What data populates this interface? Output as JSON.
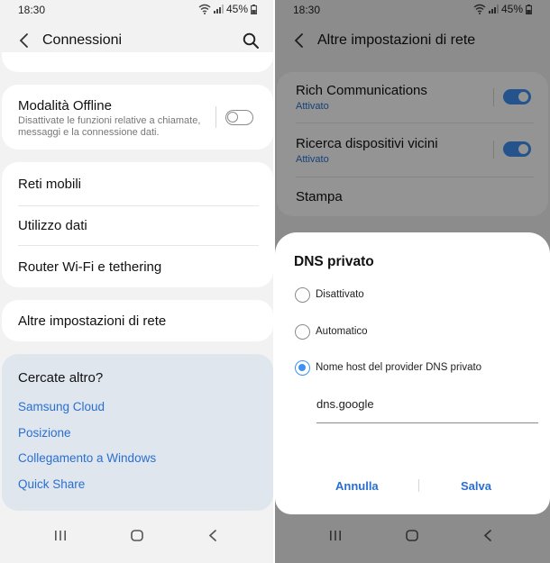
{
  "status": {
    "time": "18:30",
    "battery": "45%"
  },
  "left": {
    "title": "Connessioni",
    "offline": {
      "title": "Modalità Offline",
      "subtitle_line1": "Disattivate le funzioni relative a chiamate,",
      "subtitle_line2": "messaggi e la connessione dati.",
      "enabled": false
    },
    "menu": [
      "Reti mobili",
      "Utilizzo dati",
      "Router Wi-Fi e tethering"
    ],
    "more_settings": "Altre impostazioni di rete",
    "suggest": {
      "title": "Cercate altro?",
      "links": [
        "Samsung Cloud",
        "Posizione",
        "Collegamento a Windows",
        "Quick Share"
      ]
    }
  },
  "right": {
    "title": "Altre impostazioni di rete",
    "rows": [
      {
        "title": "Rich Communications",
        "subtitle": "Attivato",
        "enabled": true
      },
      {
        "title": "Ricerca dispositivi vicini",
        "subtitle": "Attivato",
        "enabled": true
      }
    ],
    "stampa": "Stampa",
    "dialog": {
      "title": "DNS privato",
      "options": [
        "Disattivato",
        "Automatico",
        "Nome host del provider DNS privato"
      ],
      "selected": 2,
      "hostname": "dns.google",
      "cancel": "Annulla",
      "save": "Salva"
    }
  },
  "colors": {
    "accent": "#3e91f0",
    "link": "#2a6fd0",
    "suggest_bg": "#dfe6ee"
  }
}
